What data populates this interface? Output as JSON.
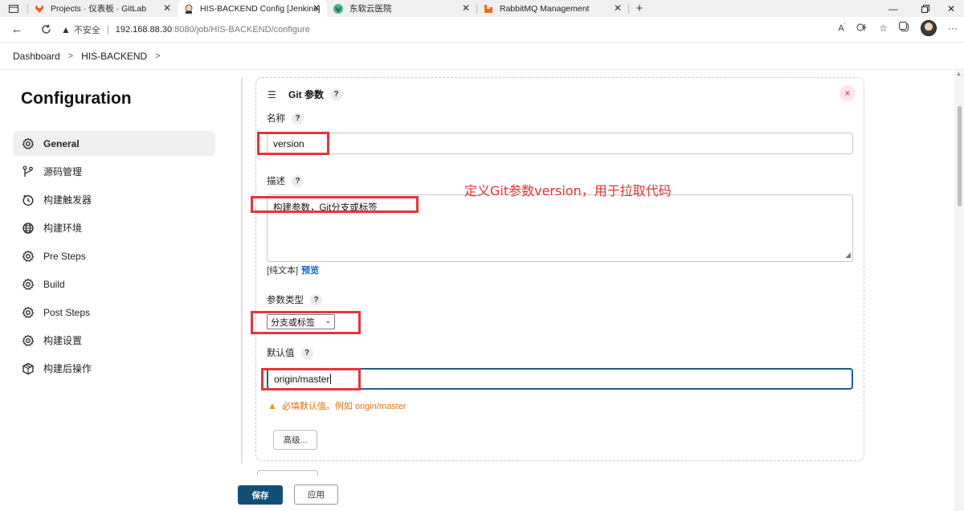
{
  "browser": {
    "tabs": [
      {
        "title": "Projects · 仪表板 · GitLab",
        "icon": "gitlab-icon"
      },
      {
        "title": "HIS-BACKEND Config [Jenkins]",
        "icon": "jenkins-icon",
        "active": true
      },
      {
        "title": "东软云医院",
        "icon": "vue-icon"
      },
      {
        "title": "RabbitMQ Management",
        "icon": "rabbitmq-icon"
      }
    ],
    "security_label": "不安全",
    "url_host": "192.168.88.30",
    "url_rest": ":8080/job/HIS-BACKEND/configure"
  },
  "breadcrumb": {
    "items": [
      "Dashboard",
      "HIS-BACKEND"
    ]
  },
  "page": {
    "title": "Configuration"
  },
  "sidebar": {
    "items": [
      {
        "label": "General",
        "icon": "gear-icon",
        "active": true
      },
      {
        "label": "源码管理",
        "icon": "branch-icon"
      },
      {
        "label": "构建触发器",
        "icon": "clock-icon"
      },
      {
        "label": "构建环境",
        "icon": "globe-icon"
      },
      {
        "label": "Pre Steps",
        "icon": "gear-icon"
      },
      {
        "label": "Build",
        "icon": "gear-icon"
      },
      {
        "label": "Post Steps",
        "icon": "gear-icon"
      },
      {
        "label": "构建设置",
        "icon": "gear-icon"
      },
      {
        "label": "构建后操作",
        "icon": "package-icon"
      }
    ]
  },
  "param_block": {
    "title": "Git 参数",
    "name_label": "名称",
    "name_value": "version",
    "desc_label": "描述",
    "desc_value": "构建参数，Git分支或标签",
    "format_plain": "[纯文本]",
    "format_preview": "预览",
    "type_label": "参数类型",
    "type_value": "分支或标签",
    "default_label": "默认值",
    "default_value": "origin/master",
    "default_warning": "必填默认值。例如 origin/master",
    "advanced_label": "高级...",
    "help_glyph": "?",
    "close_glyph": "×"
  },
  "annotation": {
    "text": "定义Git参数version，用于拉取代码",
    "color": "#e8343b"
  },
  "footer": {
    "save_label": "保存",
    "apply_label": "应用"
  },
  "colors": {
    "save_button": "#134f75",
    "link": "#1068c5",
    "warning": "#e07412"
  }
}
